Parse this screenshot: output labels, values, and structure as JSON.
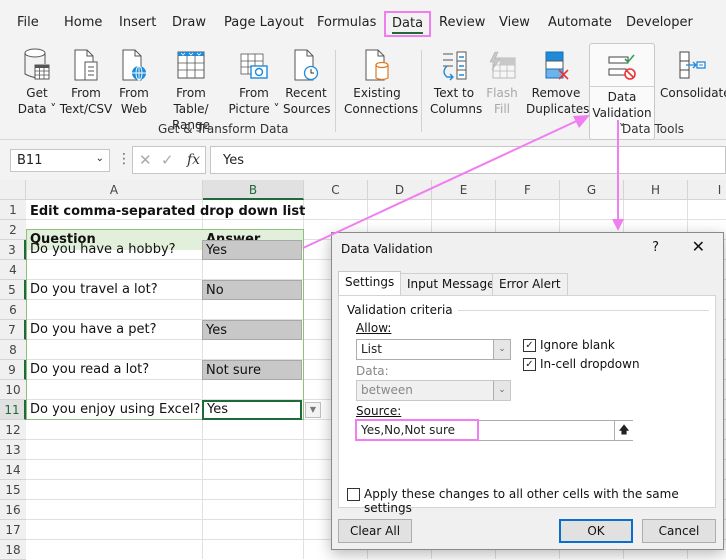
{
  "menu": {
    "tabs": [
      "File",
      "Home",
      "Insert",
      "Draw",
      "Page Layout",
      "Formulas",
      "Data",
      "Review",
      "View",
      "Automate",
      "Developer"
    ],
    "active_tab": "Data"
  },
  "ribbon": {
    "get_transform": {
      "buttons": [
        {
          "line1": "Get",
          "line2": "Data ˅",
          "icon": "database-icon"
        },
        {
          "line1": "From",
          "line2": "Text/CSV",
          "icon": "text-file-icon"
        },
        {
          "line1": "From",
          "line2": "Web",
          "icon": "web-file-icon"
        },
        {
          "line1": "From Table/",
          "line2": "Range",
          "icon": "table-icon"
        },
        {
          "line1": "From",
          "line2": "Picture ˅",
          "icon": "camera-table-icon"
        },
        {
          "line1": "Recent",
          "line2": "Sources",
          "icon": "recent-file-icon"
        },
        {
          "line1": "Existing",
          "line2": "Connections",
          "icon": "connections-icon"
        }
      ],
      "label": "Get & Transform Data"
    },
    "data_tools": {
      "buttons": [
        {
          "line1": "Text to",
          "line2": "Columns",
          "icon": "text-to-columns-icon",
          "disabled": false
        },
        {
          "line1": "Flash",
          "line2": "Fill",
          "icon": "flash-fill-icon",
          "disabled": true
        },
        {
          "line1": "Remove",
          "line2": "Duplicates",
          "icon": "remove-duplicates-icon",
          "disabled": false
        },
        {
          "line1": "Data",
          "line2": "Validation ˅",
          "icon": "data-validation-icon",
          "disabled": false
        },
        {
          "line1": "Consolidate",
          "line2": "",
          "icon": "consolidate-icon",
          "disabled": false
        }
      ],
      "label": "Data Tools"
    }
  },
  "formula_bar": {
    "name_box": "B11",
    "fx": "fx",
    "value": "Yes"
  },
  "sheet": {
    "columns": [
      "A",
      "B",
      "C",
      "D",
      "E",
      "F",
      "G",
      "H",
      "I"
    ],
    "selected_column": "B",
    "rows": [
      "1",
      "2",
      "3",
      "4",
      "5",
      "6",
      "7",
      "8",
      "9",
      "10",
      "11",
      "12",
      "13",
      "14",
      "15",
      "16",
      "17",
      "18"
    ],
    "title": "Edit comma-separated drop down list",
    "header": {
      "question": "Question",
      "answer": "Answer"
    },
    "entries": [
      {
        "row": 3,
        "question": "Do you have a hobby?",
        "answer": "Yes"
      },
      {
        "row": 5,
        "question": "Do you travel a lot?",
        "answer": "No"
      },
      {
        "row": 7,
        "question": "Do you have a pet?",
        "answer": "Yes"
      },
      {
        "row": 9,
        "question": "Do you read a lot?",
        "answer": "Not sure"
      },
      {
        "row": 11,
        "question": "Do you enjoy using Excel?",
        "answer": "Yes"
      }
    ],
    "active_cell": "B11"
  },
  "dialog": {
    "title": "Data Validation",
    "help": "?",
    "close": "✕",
    "tabs": [
      "Settings",
      "Input Message",
      "Error Alert"
    ],
    "active_tab": "Settings",
    "section": "Validation criteria",
    "allow_label": "Allow:",
    "allow_value": "List",
    "data_label": "Data:",
    "data_value": "between",
    "ignore_blank": {
      "label": "Ignore blank",
      "checked": true
    },
    "in_cell_dropdown": {
      "label": "In-cell dropdown",
      "checked": true
    },
    "source_label": "Source:",
    "source_value": "Yes,No,Not sure",
    "apply_all": {
      "label": "Apply these changes to all other cells with the same settings",
      "checked": false
    },
    "buttons": {
      "clear_all": "Clear All",
      "ok": "OK",
      "cancel": "Cancel"
    }
  },
  "colors": {
    "highlight": "#f07ef0",
    "excel_green": "#1e6b3a",
    "header_fill": "#e2efda",
    "answer_fill": "#c8c8c8",
    "ok_border": "#0a6ed1"
  }
}
